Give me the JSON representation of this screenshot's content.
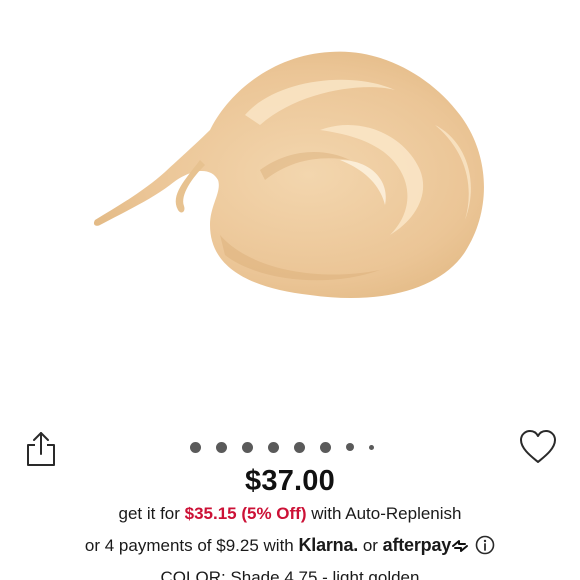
{
  "product": {
    "image_alt": "foundation swatch"
  },
  "carousel": {
    "dot_count": 8,
    "active_index": 0
  },
  "pricing": {
    "price": "$37.00",
    "autoreplenish_prefix": "get it for ",
    "autoreplenish_sale": "$35.15 (5% Off)",
    "autoreplenish_suffix": " with Auto-Replenish",
    "installments_prefix": "or 4 payments of $9.25 with ",
    "klarna_label": "Klarna.",
    "or_label": " or ",
    "afterpay_label": "afterpay"
  },
  "variant": {
    "color_label": "COLOR: Shade 4.75 - light golden"
  },
  "icons": {
    "share": "share-icon",
    "favorite": "heart-icon",
    "info": "info-icon",
    "afterpay_logo": "afterpay-arrows-icon"
  },
  "colors": {
    "sale_red": "#cc1136",
    "swatch_base": "#ecc99c",
    "text": "#1a1a1a"
  }
}
